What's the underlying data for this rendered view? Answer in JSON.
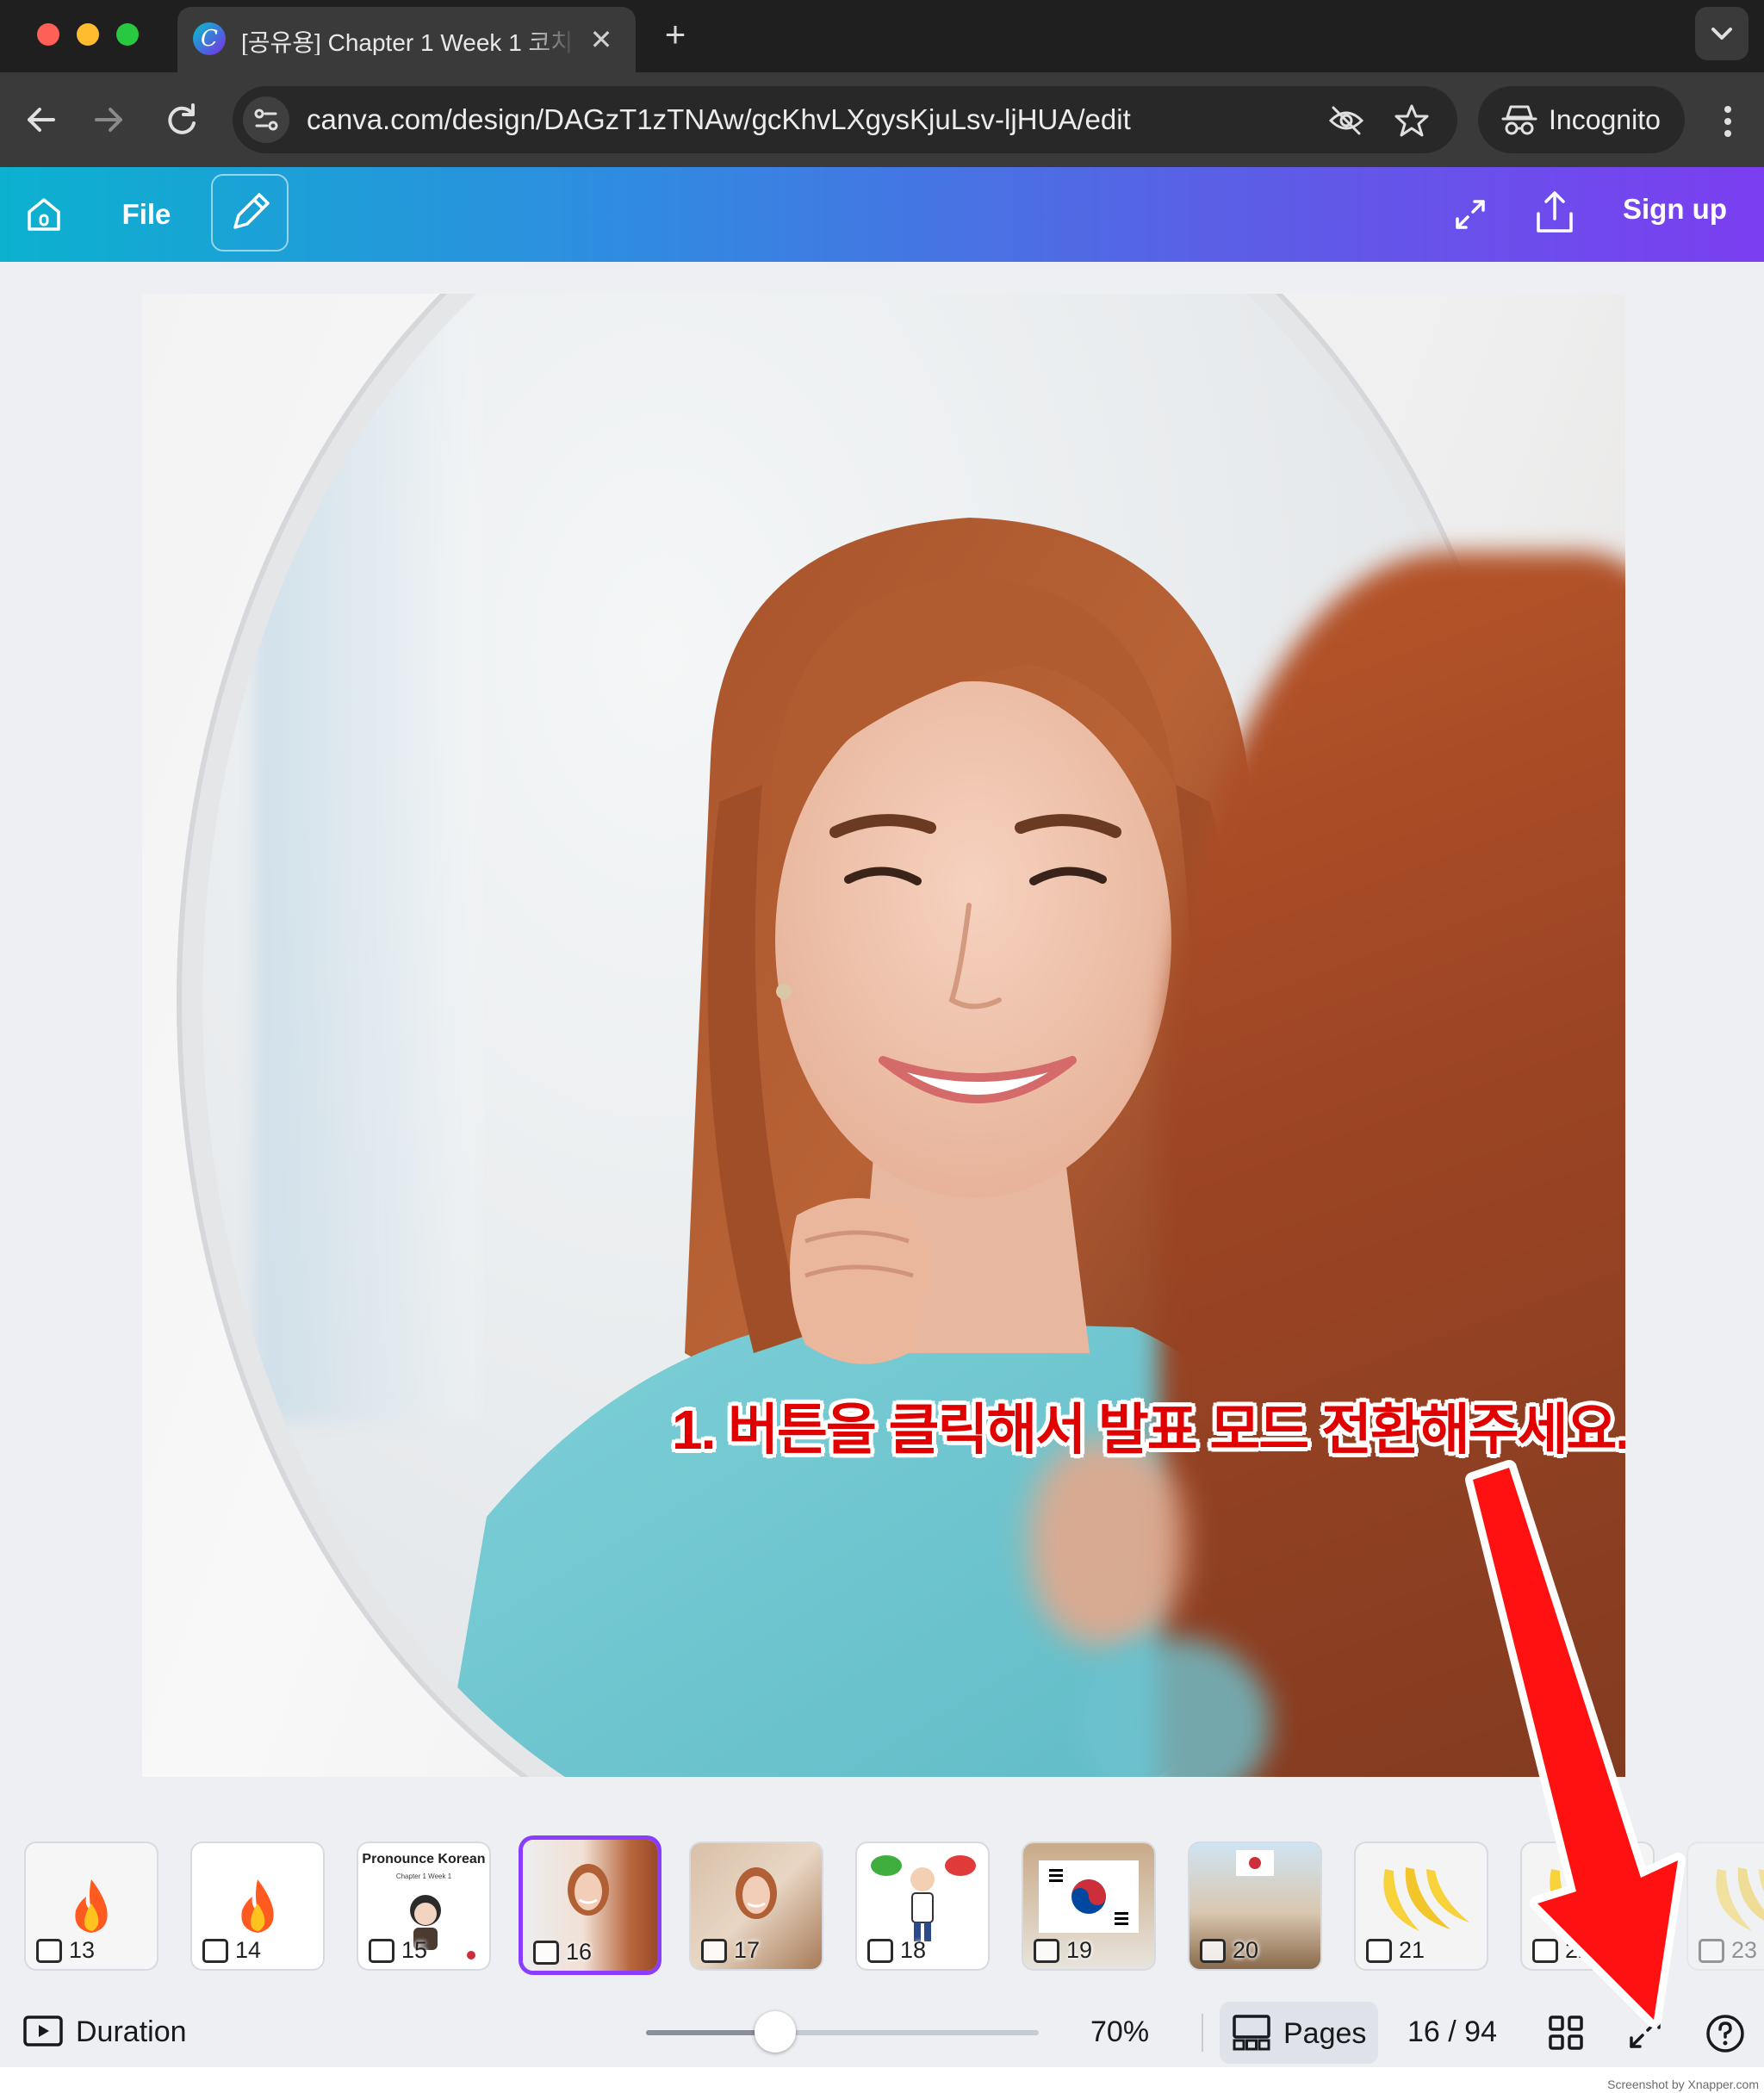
{
  "browser": {
    "tab_title": "[공유용] Chapter 1 Week 1 코치",
    "url": "canva.com/design/DAGzT1zTNAw/gcKhvLXgysKjuLsv-ljHUA/edit",
    "incognito_label": "Incognito"
  },
  "header": {
    "file_label": "File",
    "signup_label": "Sign up"
  },
  "canvas": {
    "caption": "1. 버튼을 클릭해서 발표 모드 전환해주세요."
  },
  "thumbnails": [
    {
      "number": "13",
      "kind": "flame"
    },
    {
      "number": "14",
      "kind": "flame"
    },
    {
      "number": "15",
      "kind": "title",
      "title": "Pronounce Korean",
      "subtitle": "Chapter 1 Week 1"
    },
    {
      "number": "16",
      "kind": "photo",
      "active": true
    },
    {
      "number": "17",
      "kind": "photo"
    },
    {
      "number": "18",
      "kind": "yesno"
    },
    {
      "number": "19",
      "kind": "flag"
    },
    {
      "number": "20",
      "kind": "village"
    },
    {
      "number": "21",
      "kind": "banana"
    },
    {
      "number": "22",
      "kind": "banana"
    },
    {
      "number": "23",
      "kind": "banana"
    }
  ],
  "bottombar": {
    "duration_label": "Duration",
    "zoom_label": "70%",
    "zoom_level": 0.33,
    "pages_label": "Pages",
    "page_count": "16 / 94"
  },
  "credit": "Screenshot by Xnapper.com"
}
